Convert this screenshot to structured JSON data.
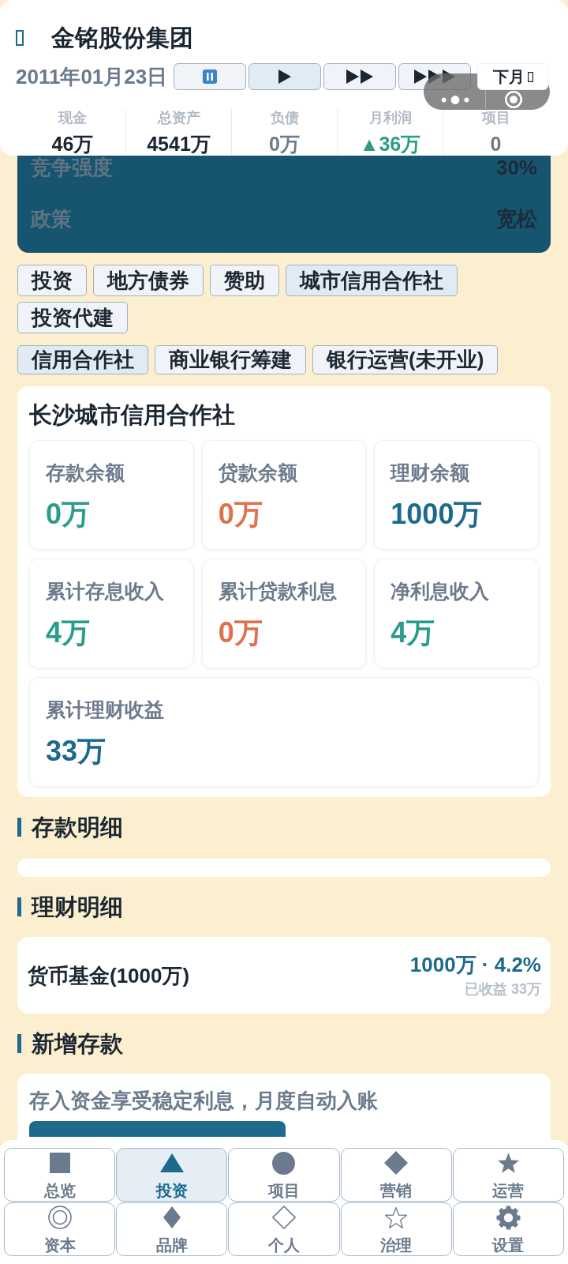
{
  "header": {
    "title": "金铭股份集团",
    "date": "2011年01月23日",
    "speed_buttons": [
      {
        "kind": "pause",
        "selected": false
      },
      {
        "kind": "play",
        "selected": true
      },
      {
        "kind": "fast",
        "selected": false
      },
      {
        "kind": "fastest",
        "selected": false
      }
    ],
    "next_month_button": {
      "label": "下月"
    },
    "stats": [
      {
        "label": "现金",
        "value": "46万",
        "color": "#1b2631"
      },
      {
        "label": "总资产",
        "value": "4541万",
        "color": "#1b2631"
      },
      {
        "label": "负债",
        "value": "0万",
        "color": "#6b7a8c"
      },
      {
        "label": "月利润",
        "value": "▲36万",
        "color": "#2a9d80"
      },
      {
        "label": "项目",
        "value": "0",
        "color": "#6b7a8c"
      }
    ]
  },
  "market": [
    {
      "label": "竞争强度",
      "value": "30%"
    },
    {
      "label": "政策",
      "value": "宽松"
    }
  ],
  "category_tabs": [
    {
      "label": "投资",
      "selected": false
    },
    {
      "label": "地方债券",
      "selected": false
    },
    {
      "label": "赞助",
      "selected": false
    },
    {
      "label": "城市信用合作社",
      "selected": true
    },
    {
      "label": "投资代建",
      "selected": false
    }
  ],
  "subcategory_tabs": [
    {
      "label": "信用合作社",
      "selected": true
    },
    {
      "label": "商业银行筹建",
      "selected": false
    },
    {
      "label": "银行运营(未开业)",
      "selected": false
    }
  ],
  "credit_union": {
    "title": "长沙城市信用合作社",
    "metrics": [
      {
        "label": "存款余额",
        "value": "0万",
        "color": "#2a9d8a"
      },
      {
        "label": "贷款余额",
        "value": "0万",
        "color": "#e0714f"
      },
      {
        "label": "理财余额",
        "value": "1000万",
        "color": "#1d6a8c"
      },
      {
        "label": "累计存息收入",
        "value": "4万",
        "color": "#2a9d8a"
      },
      {
        "label": "累计贷款利息",
        "value": "0万",
        "color": "#e0714f"
      },
      {
        "label": "净利息收入",
        "value": "4万",
        "color": "#2a9d8a"
      },
      {
        "label": "累计理财收益",
        "value": "33万",
        "color": "#1d6a8c"
      }
    ]
  },
  "deposit_details": {
    "heading": "存款明细"
  },
  "wealth_details": {
    "heading": "理财明细",
    "items": [
      {
        "name": "货币基金(1000万)",
        "summary": "1000万 · 4.2%",
        "earned": "已收益 33万"
      }
    ]
  },
  "new_deposit": {
    "heading": "新增存款",
    "note": "存入资金享受稳定利息，月度自动入账"
  },
  "bottom_nav": [
    {
      "label": "总览",
      "selected": false
    },
    {
      "label": "投资",
      "selected": true
    },
    {
      "label": "项目",
      "selected": false
    },
    {
      "label": "营销",
      "selected": false
    },
    {
      "label": "运营",
      "selected": false
    },
    {
      "label": "资本",
      "selected": false
    },
    {
      "label": "品牌",
      "selected": false
    },
    {
      "label": "个人",
      "selected": false
    },
    {
      "label": "治理",
      "selected": false
    },
    {
      "label": "设置",
      "selected": false
    }
  ]
}
